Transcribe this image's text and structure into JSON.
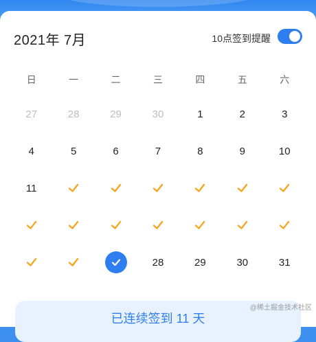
{
  "calendar": {
    "title": "2021年 7月",
    "weekdays": [
      "日",
      "一",
      "二",
      "三",
      "四",
      "五",
      "六"
    ],
    "weeks": [
      [
        {
          "d": "27",
          "muted": true
        },
        {
          "d": "28",
          "muted": true
        },
        {
          "d": "29",
          "muted": true
        },
        {
          "d": "30",
          "muted": true
        },
        {
          "d": "1"
        },
        {
          "d": "2"
        },
        {
          "d": "3"
        }
      ],
      [
        {
          "d": "4"
        },
        {
          "d": "5"
        },
        {
          "d": "6"
        },
        {
          "d": "7"
        },
        {
          "d": "8"
        },
        {
          "d": "9"
        },
        {
          "d": "10"
        }
      ],
      [
        {
          "d": "11"
        },
        {
          "checked": true
        },
        {
          "checked": true
        },
        {
          "checked": true
        },
        {
          "checked": true
        },
        {
          "checked": true
        },
        {
          "checked": true
        }
      ],
      [
        {
          "checked": true
        },
        {
          "checked": true
        },
        {
          "checked": true
        },
        {
          "checked": true
        },
        {
          "checked": true
        },
        {
          "checked": true
        },
        {
          "checked": true
        }
      ],
      [
        {
          "checked": true
        },
        {
          "checked": true
        },
        {
          "today": true
        },
        {
          "d": "28"
        },
        {
          "d": "29"
        },
        {
          "d": "30"
        },
        {
          "d": "31"
        }
      ]
    ]
  },
  "reminder": {
    "label": "10点签到提醒",
    "enabled": true
  },
  "summary": {
    "text": "已连续签到 11 天"
  },
  "watermark": "@稀土掘金技术社区",
  "colors": {
    "accent": "#2f7ef0",
    "check": "#f5a623"
  },
  "icons": {
    "checkmark": "checkmark-icon",
    "today": "today-check-icon"
  }
}
